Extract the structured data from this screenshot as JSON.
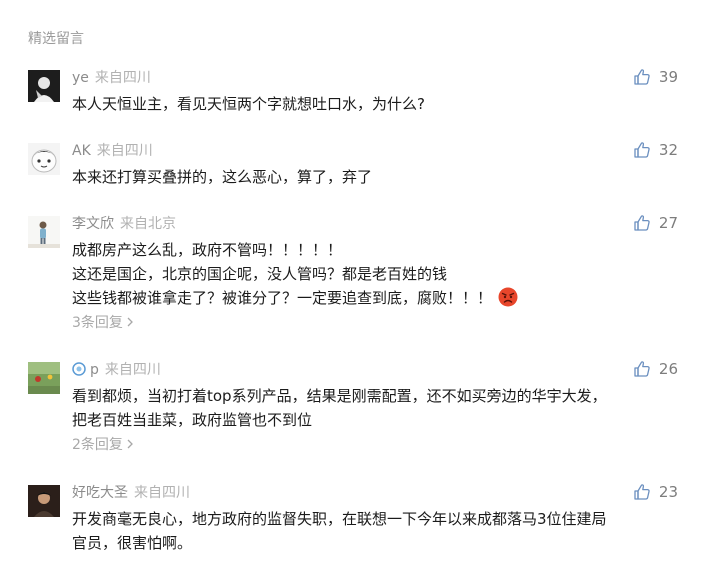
{
  "section_title": "精选留言",
  "comments": [
    {
      "nickname": "ye",
      "location": "来自四川",
      "likes": "39",
      "lines": [
        "本人天恒业主，看见天恒两个字就想吐口水，为什么?"
      ]
    },
    {
      "nickname": "AK",
      "location": "来自四川",
      "likes": "32",
      "lines": [
        "本来还打算买叠拼的，这么恶心，算了，弃了"
      ]
    },
    {
      "nickname": "李文欣",
      "location": "来自北京",
      "likes": "27",
      "lines": [
        "成都房产这么乱，政府不管吗！！！！！",
        "这还是国企，北京的国企呢，没人管吗？都是老百姓的钱",
        "这些钱都被谁拿走了？被谁分了？一定要追查到底，腐败！！！"
      ],
      "emoji": "angry-face-icon",
      "replies": "3条回复"
    },
    {
      "nickname": "p",
      "location": "来自四川",
      "likes": "26",
      "lines": [
        "看到都烦，当初打着top系列产品，结果是刚需配置，还不如买旁边的华宇大发，",
        "把老百姓当韭菜，政府监管也不到位"
      ],
      "replies": "2条回复"
    },
    {
      "nickname": "好吃大圣",
      "location": "来自四川",
      "likes": "23",
      "lines": [
        "开发商毫无良心，地方政府的监督失职，在联想一下今年以来成都落马3位住建局",
        "官员，很害怕啊。"
      ]
    }
  ],
  "colors": {
    "nickname": "#8c8c8c",
    "location": "#b2b2b2",
    "text": "#1b1b1b",
    "meta_gray": "#a8a8a8",
    "emoji_red": "#e8462b"
  }
}
